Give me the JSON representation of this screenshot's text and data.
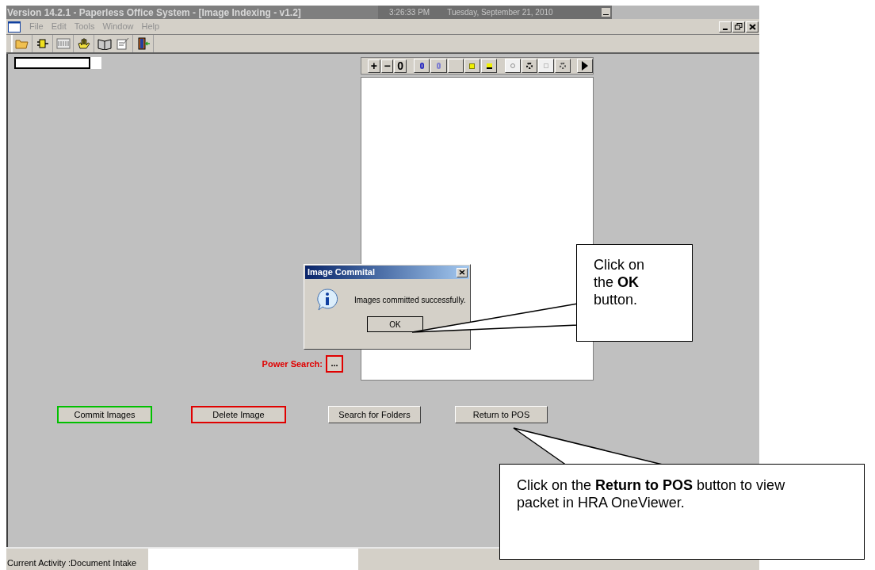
{
  "window": {
    "title": "Version 14.2.1 - Paperless Office System - [Image Indexing - v1.2]",
    "time": "3:26:33 PM",
    "date": "Tuesday, September 21, 2010"
  },
  "menu": [
    "File",
    "Edit",
    "Tools",
    "Window",
    "Help"
  ],
  "viewer_toolbar": [
    "+",
    "−",
    "0"
  ],
  "power_search": {
    "label": "Power Search:",
    "button": "..."
  },
  "buttons": [
    {
      "label": "Commit Images",
      "color": "#00c000"
    },
    {
      "label": "Delete Image",
      "color": "#e00000"
    },
    {
      "label": "Search for Folders"
    },
    {
      "label": "Return to POS"
    }
  ],
  "status_bar": {
    "activity": "Current Activity :Document Intake"
  },
  "dialog": {
    "title": "Image Commital",
    "message": "Images committed successfully.",
    "button": "OK"
  },
  "callouts": [
    {
      "text": "Click on the **OK** button."
    },
    {
      "text": "Click on the **Return to POS** button to view packet in HRA OneViewer."
    }
  ]
}
